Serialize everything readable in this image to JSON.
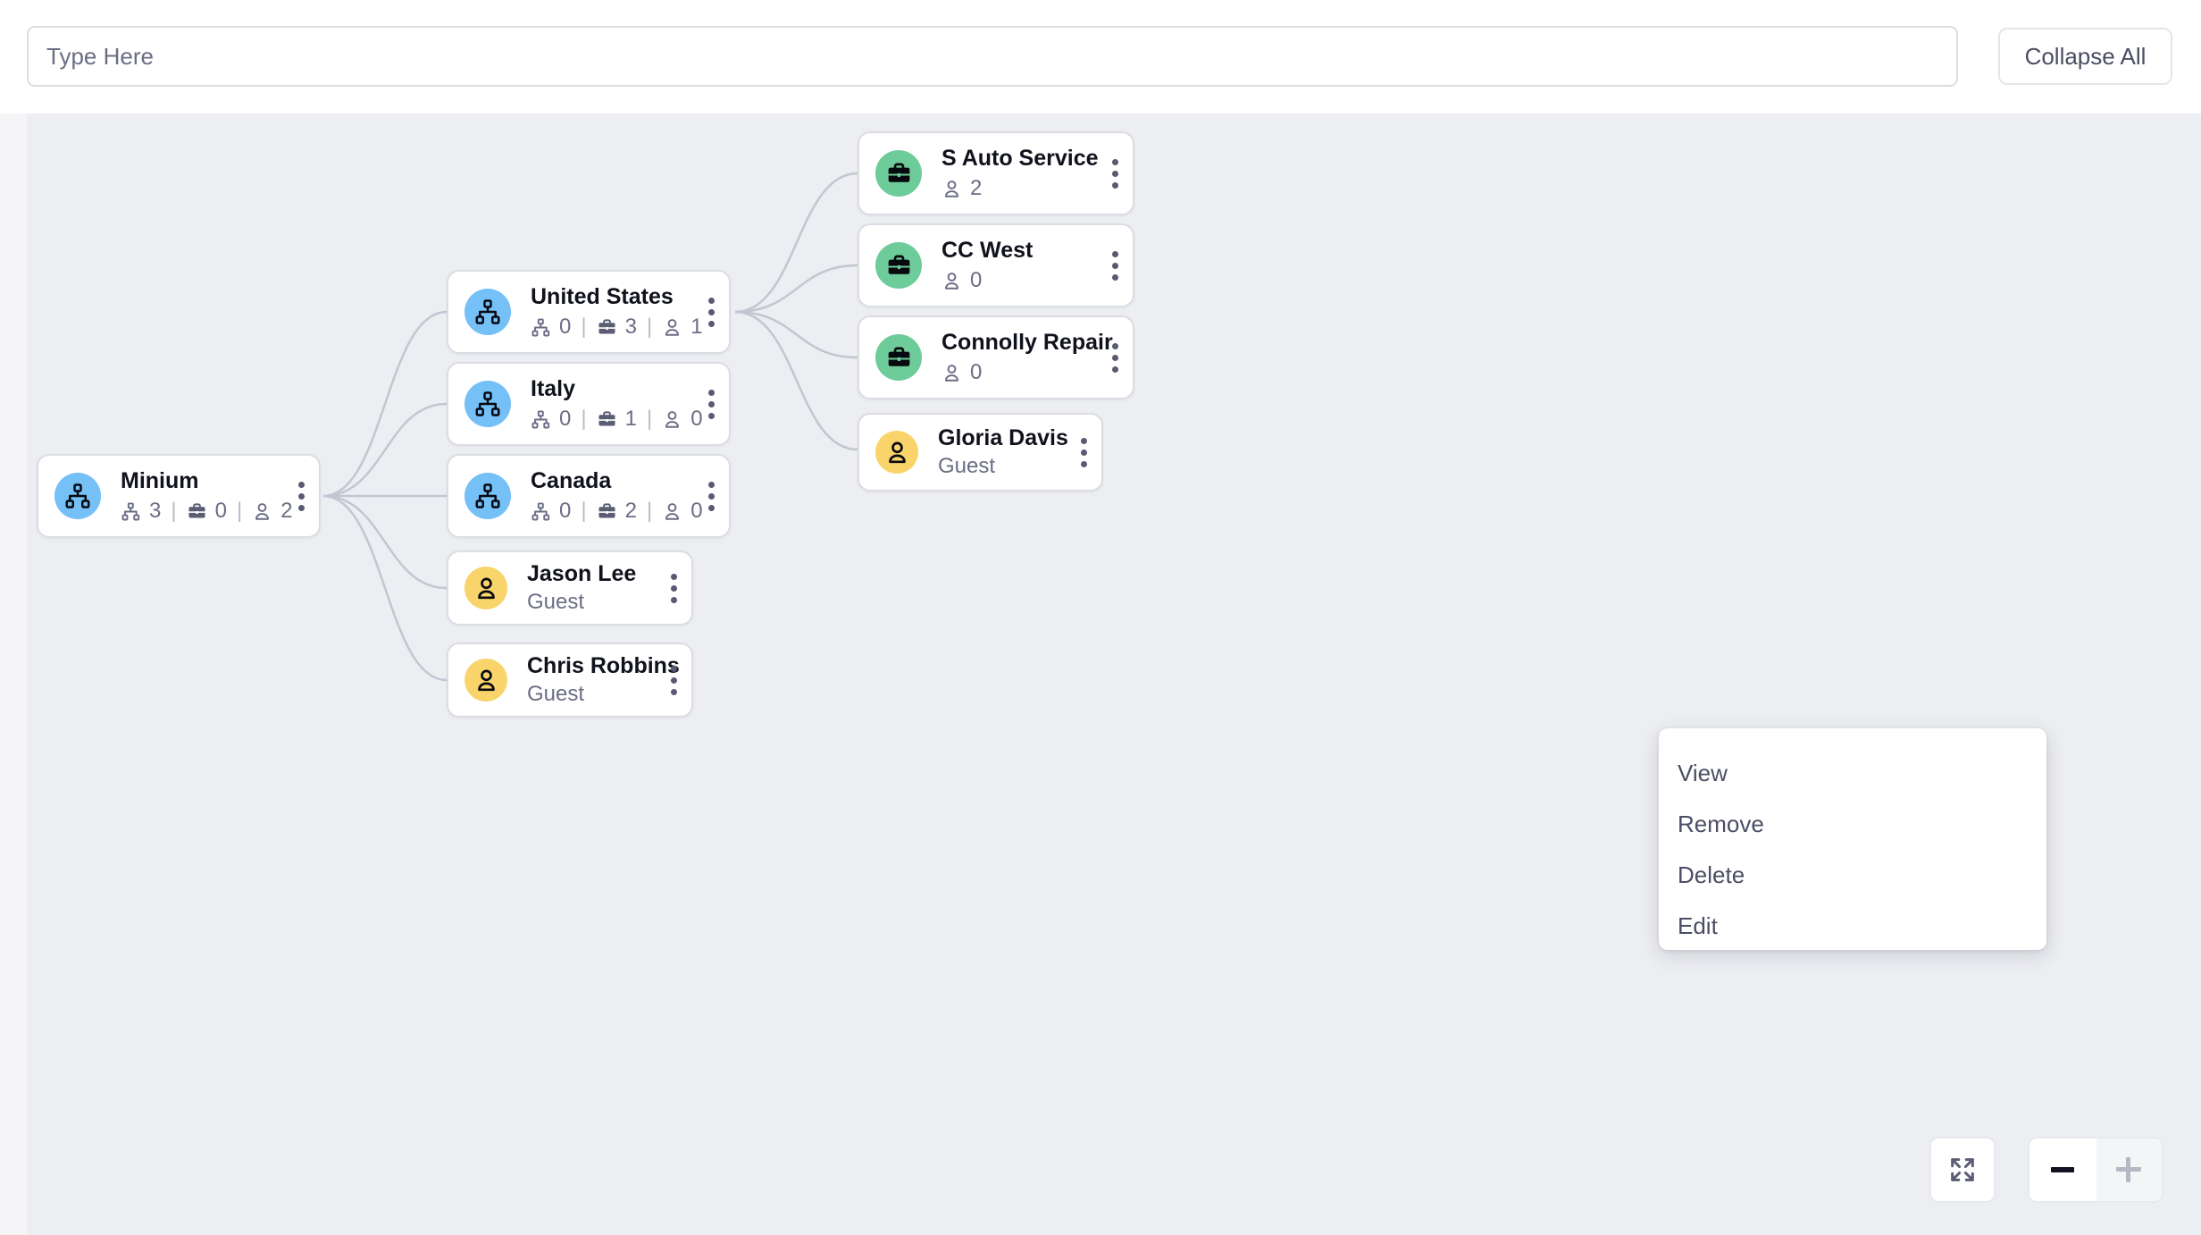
{
  "toolbar": {
    "search_placeholder": "Type Here",
    "search_value": "",
    "collapse_all_label": "Collapse All"
  },
  "tree": {
    "root": {
      "name": "Minium",
      "type": "org",
      "avatar_color": "#74c0f7",
      "stats": {
        "orgs": "3",
        "businesses": "0",
        "people": "2"
      }
    },
    "level2": [
      {
        "name": "United States",
        "type": "org",
        "avatar_color": "#74c0f7",
        "stats": {
          "orgs": "0",
          "businesses": "3",
          "people": "1"
        }
      },
      {
        "name": "Italy",
        "type": "org",
        "avatar_color": "#74c0f7",
        "stats": {
          "orgs": "0",
          "businesses": "1",
          "people": "0"
        }
      },
      {
        "name": "Canada",
        "type": "org",
        "avatar_color": "#74c0f7",
        "stats": {
          "orgs": "0",
          "businesses": "2",
          "people": "0"
        }
      },
      {
        "name": "Jason Lee",
        "type": "person",
        "avatar_color": "#f8d46a",
        "role": "Guest"
      },
      {
        "name": "Chris Robbins",
        "type": "person",
        "avatar_color": "#f8d46a",
        "role": "Guest"
      }
    ],
    "level3": [
      {
        "name": "S Auto Service",
        "type": "business",
        "avatar_color": "#6ecb9a",
        "people": "2"
      },
      {
        "name": "CC West",
        "type": "business",
        "avatar_color": "#6ecb9a",
        "people": "0"
      },
      {
        "name": "Connolly Repair",
        "type": "business",
        "avatar_color": "#6ecb9a",
        "people": "0"
      },
      {
        "name": "Gloria Davis",
        "type": "person",
        "avatar_color": "#f8d46a",
        "role": "Guest"
      }
    ]
  },
  "context_menu": {
    "items": [
      {
        "label": "View"
      },
      {
        "label": "Remove"
      },
      {
        "label": "Delete"
      },
      {
        "label": "Edit"
      }
    ]
  },
  "controls": {
    "fullscreen_icon": "expand-icon",
    "zoom_out_icon": "minus-icon",
    "zoom_in_icon": "plus-icon"
  },
  "colors": {
    "canvas_bg": "#edeef2",
    "page_bg": "#f5f5f7",
    "card_bg": "#ffffff",
    "card_border": "#dcdde4",
    "edge": "#c3c5d1",
    "text_primary": "#10121c",
    "text_secondary": "#6b6d85"
  }
}
